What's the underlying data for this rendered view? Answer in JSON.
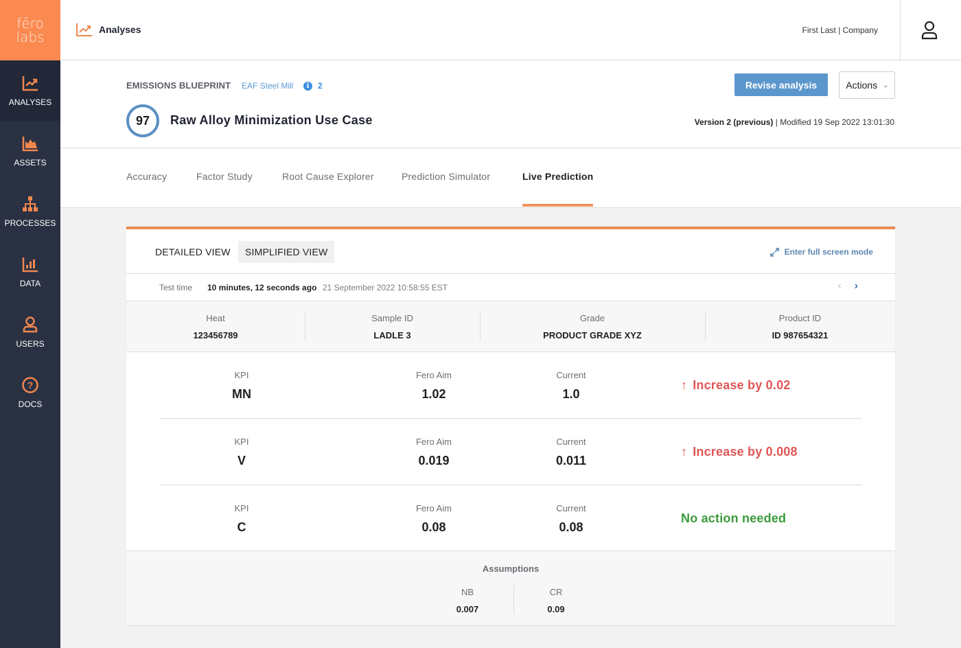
{
  "brand": {
    "line1": "fēro",
    "line2": "labs",
    "color": "#fa8a50"
  },
  "sidebar": {
    "items": [
      {
        "label": "ANALYSES",
        "icon": "analyses-icon",
        "active": true
      },
      {
        "label": "ASSETS",
        "icon": "assets-icon"
      },
      {
        "label": "PROCESSES",
        "icon": "processes-icon"
      },
      {
        "label": "DATA",
        "icon": "data-icon"
      },
      {
        "label": "USERS",
        "icon": "users-icon"
      },
      {
        "label": "DOCS",
        "icon": "docs-icon"
      }
    ]
  },
  "topbar": {
    "section": "Analyses",
    "user": "First Last | Company"
  },
  "analysis": {
    "blueprint": "EMISSIONS BLUEPRINT",
    "site": "EAF Steel Mill",
    "info_count": "2",
    "score": "97",
    "title": "Raw Alloy Minimization Use Case",
    "revise_label": "Revise analysis",
    "actions_label": "Actions",
    "version": "Version 2 (previous)",
    "modified": " | Modified 19 Sep 2022 13:01:30"
  },
  "tabs": [
    {
      "label": "Accuracy"
    },
    {
      "label": "Factor Study"
    },
    {
      "label": "Root Cause Explorer"
    },
    {
      "label": "Prediction Simulator"
    },
    {
      "label": "Live Prediction",
      "active": true
    }
  ],
  "card": {
    "views": {
      "detailed": "DETAILED VIEW",
      "simplified": "SIMPLIFIED VIEW",
      "selected": "simplified"
    },
    "fullscreen_label": "Enter full screen mode",
    "test_time": {
      "label": "Test time",
      "ago": "10 minutes, 12 seconds ago",
      "date": "21 September 2022 10:58:55 EST"
    },
    "meta": [
      {
        "label": "Heat",
        "value": "123456789"
      },
      {
        "label": "Sample ID",
        "value": "LADLE 3"
      },
      {
        "label": "Grade",
        "value": "PRODUCT GRADE XYZ"
      },
      {
        "label": "Product ID",
        "value": "ID 987654321"
      }
    ],
    "kpi_headers": {
      "kpi": "KPI",
      "aim": "Fero Aim",
      "current": "Current"
    },
    "kpis": [
      {
        "kpi": "MN",
        "aim": "1.02",
        "current": "1.0",
        "action": "Increase by 0.02",
        "status": "increase",
        "arrow": "↑"
      },
      {
        "kpi": "V",
        "aim": "0.019",
        "current": "0.011",
        "action": "Increase by 0.008",
        "status": "increase",
        "arrow": "↑"
      },
      {
        "kpi": "C",
        "aim": "0.08",
        "current": "0.08",
        "action": "No action needed",
        "status": "ok",
        "arrow": ""
      }
    ],
    "assumptions": {
      "title": "Assumptions",
      "items": [
        {
          "label": "NB",
          "value": "0.007"
        },
        {
          "label": "CR",
          "value": "0.09"
        }
      ]
    }
  },
  "colors": {
    "accent": "#ec8b53",
    "primary": "#5b97cd",
    "increase": "#e05656",
    "ok": "#3a9a3a",
    "sidebar": "#2a3142"
  }
}
